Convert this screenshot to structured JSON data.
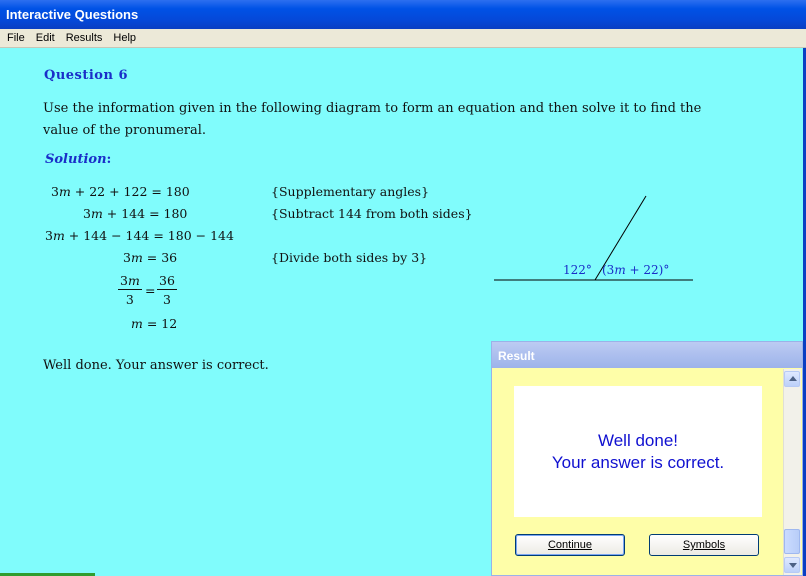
{
  "window": {
    "title": "Interactive Questions"
  },
  "menu": [
    "File",
    "Edit",
    "Results",
    "Help"
  ],
  "question": {
    "title": "Question 6",
    "text": "Use the information given in the following diagram to form an equation and then solve it to find the value of the pronumeral."
  },
  "solution": {
    "label": "Solution",
    "colon": ":",
    "lines": [
      {
        "pre": "3",
        "var": "m",
        "post": " + 22 + 122 = 180",
        "reason": "{Supplementary angles}"
      },
      {
        "pre": "3",
        "var": "m",
        "post": " + 144 = 180",
        "reason": "{Subtract 144 from both sides}"
      },
      {
        "pre": "3",
        "var": "m",
        "post": " + 144 − 144 = 180 − 144",
        "reason": ""
      },
      {
        "pre": "3",
        "var": "m",
        "post": " = 36",
        "reason": "{Divide both sides by 3}"
      }
    ],
    "fraction": {
      "left_num_pre": "3",
      "left_num_var": "m",
      "left_den": "3",
      "eq": "=",
      "right_num": "36",
      "right_den": "3"
    },
    "final": {
      "var": "m",
      "post": " = 12"
    }
  },
  "diagram": {
    "angle_left": "122°",
    "angle_right_pre": "(3",
    "angle_right_var": "m",
    "angle_right_post": " + 22)°",
    "label_color": "#1a2ec8"
  },
  "feedback": "Well done.  Your answer is correct.",
  "dialog": {
    "title": "Result",
    "message_line1": "Well done!",
    "message_line2": "Your answer is correct.",
    "buttons": {
      "continue": "Continue",
      "symbols": "Symbols"
    }
  },
  "icons": {
    "scroll_up": "triangle-up-icon",
    "scroll_down": "triangle-down-icon"
  }
}
